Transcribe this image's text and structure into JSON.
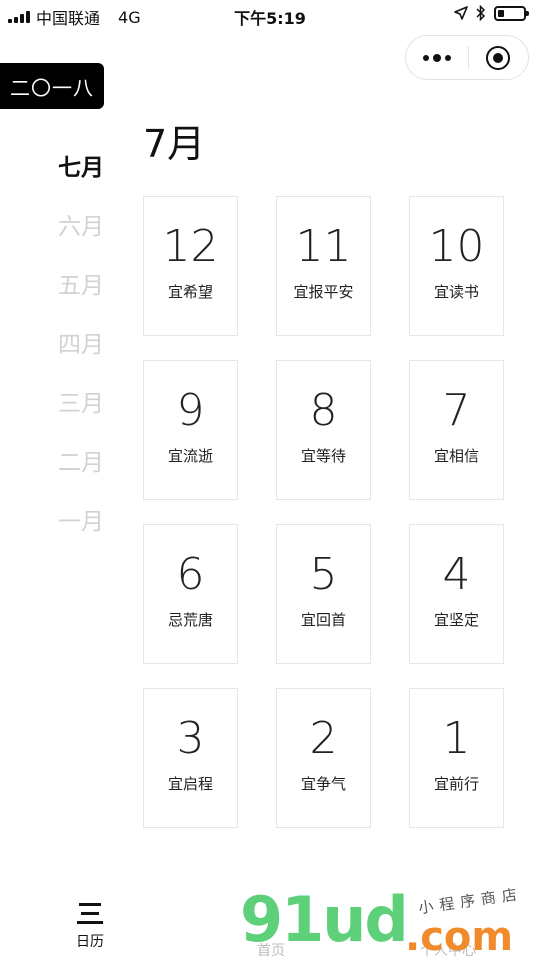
{
  "status_bar": {
    "carrier": "中国联通",
    "network": "4G",
    "time": "下午5:19",
    "battery_level": 0.25
  },
  "capsule": {
    "more_icon": "more-dots-icon",
    "close_icon": "target-close-icon"
  },
  "year_label": "二〇一八",
  "current_month_title": "7月",
  "months": [
    "七月",
    "六月",
    "五月",
    "四月",
    "三月",
    "二月",
    "一月"
  ],
  "active_month_index": 0,
  "days": [
    {
      "day": "12",
      "note": "宜希望"
    },
    {
      "day": "11",
      "note": "宜报平安"
    },
    {
      "day": "10",
      "note": "宜读书"
    },
    {
      "day": "9",
      "note": "宜流逝"
    },
    {
      "day": "8",
      "note": "宜等待"
    },
    {
      "day": "7",
      "note": "宜相信"
    },
    {
      "day": "6",
      "note": "忌荒唐"
    },
    {
      "day": "5",
      "note": "宜回首"
    },
    {
      "day": "4",
      "note": "宜坚定"
    },
    {
      "day": "3",
      "note": "宜启程"
    },
    {
      "day": "2",
      "note": "宜争气"
    },
    {
      "day": "1",
      "note": "宜前行"
    }
  ],
  "tabbar": {
    "calendar_label": "日历",
    "calendar_icon": "menu-icon",
    "home_label": "首页",
    "personal_label": "个人中心"
  },
  "watermark": {
    "logo_text": "91ud",
    "domain_text": ".com",
    "subtitle": "小程序商店"
  },
  "colors": {
    "active_text": "#111111",
    "inactive_month": "#d2d2d2",
    "card_border": "#e6e6e6",
    "year_bg": "#000000",
    "watermark_green": "#5fd07a",
    "watermark_orange": "#f08a2a"
  }
}
